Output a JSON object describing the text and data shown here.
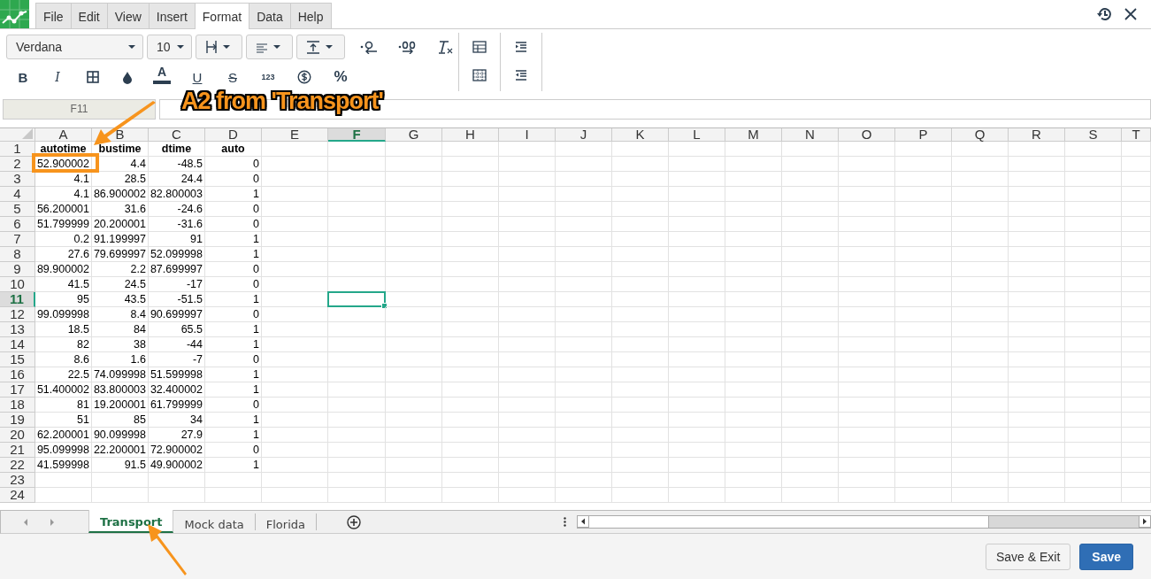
{
  "menu": [
    {
      "label": "File",
      "selected": false
    },
    {
      "label": "Edit",
      "selected": false
    },
    {
      "label": "View",
      "selected": false
    },
    {
      "label": "Insert",
      "selected": false
    },
    {
      "label": "Format",
      "selected": true
    },
    {
      "label": "Data",
      "selected": false
    },
    {
      "label": "Help",
      "selected": false
    }
  ],
  "toolbar": {
    "font": "Verdana",
    "size": "10",
    "style_labels": [
      "B",
      "I",
      "A",
      "U",
      "S",
      "123",
      "%"
    ]
  },
  "name_box": "F11",
  "columns": [
    {
      "label": "A",
      "selected": false
    },
    {
      "label": "B",
      "selected": false
    },
    {
      "label": "C",
      "selected": false
    },
    {
      "label": "D",
      "selected": false
    },
    {
      "label": "E",
      "selected": false
    },
    {
      "label": "F",
      "selected": true
    },
    {
      "label": "G",
      "selected": false
    },
    {
      "label": "H",
      "selected": false
    },
    {
      "label": "I",
      "selected": false
    },
    {
      "label": "J",
      "selected": false
    },
    {
      "label": "K",
      "selected": false
    },
    {
      "label": "L",
      "selected": false
    },
    {
      "label": "M",
      "selected": false
    },
    {
      "label": "N",
      "selected": false
    },
    {
      "label": "O",
      "selected": false
    },
    {
      "label": "P",
      "selected": false
    },
    {
      "label": "Q",
      "selected": false
    },
    {
      "label": "R",
      "selected": false
    },
    {
      "label": "S",
      "selected": false
    },
    {
      "label": "T",
      "selected": false
    }
  ],
  "rows": [
    {
      "label": "1",
      "kind": "header",
      "selected": false,
      "cells": [
        "autotime",
        "bustime",
        "dtime",
        "auto"
      ]
    },
    {
      "label": "2",
      "kind": "data",
      "selected": false,
      "cells": [
        "52.900002",
        "4.4",
        "-48.5",
        "0"
      ]
    },
    {
      "label": "3",
      "kind": "data",
      "selected": false,
      "cells": [
        "4.1",
        "28.5",
        "24.4",
        "0"
      ]
    },
    {
      "label": "4",
      "kind": "data",
      "selected": false,
      "cells": [
        "4.1",
        "86.900002",
        "82.800003",
        "1"
      ]
    },
    {
      "label": "5",
      "kind": "data",
      "selected": false,
      "cells": [
        "56.200001",
        "31.6",
        "-24.6",
        "0"
      ]
    },
    {
      "label": "6",
      "kind": "data",
      "selected": false,
      "cells": [
        "51.799999",
        "20.200001",
        "-31.6",
        "0"
      ]
    },
    {
      "label": "7",
      "kind": "data",
      "selected": false,
      "cells": [
        "0.2",
        "91.199997",
        "91",
        "1"
      ]
    },
    {
      "label": "8",
      "kind": "data",
      "selected": false,
      "cells": [
        "27.6",
        "79.699997",
        "52.099998",
        "1"
      ]
    },
    {
      "label": "9",
      "kind": "data",
      "selected": false,
      "cells": [
        "89.900002",
        "2.2",
        "87.699997",
        "0"
      ]
    },
    {
      "label": "10",
      "kind": "data",
      "selected": false,
      "cells": [
        "41.5",
        "24.5",
        "-17",
        "0"
      ]
    },
    {
      "label": "11",
      "kind": "data",
      "selected": true,
      "cells": [
        "95",
        "43.5",
        "-51.5",
        "1"
      ]
    },
    {
      "label": "12",
      "kind": "data",
      "selected": false,
      "cells": [
        "99.099998",
        "8.4",
        "90.699997",
        "0"
      ]
    },
    {
      "label": "13",
      "kind": "data",
      "selected": false,
      "cells": [
        "18.5",
        "84",
        "65.5",
        "1"
      ]
    },
    {
      "label": "14",
      "kind": "data",
      "selected": false,
      "cells": [
        "82",
        "38",
        "-44",
        "1"
      ]
    },
    {
      "label": "15",
      "kind": "data",
      "selected": false,
      "cells": [
        "8.6",
        "1.6",
        "-7",
        "0"
      ]
    },
    {
      "label": "16",
      "kind": "data",
      "selected": false,
      "cells": [
        "22.5",
        "74.099998",
        "51.599998",
        "1"
      ]
    },
    {
      "label": "17",
      "kind": "data",
      "selected": false,
      "cells": [
        "51.400002",
        "83.800003",
        "32.400002",
        "1"
      ]
    },
    {
      "label": "18",
      "kind": "data",
      "selected": false,
      "cells": [
        "81",
        "19.200001",
        "61.799999",
        "0"
      ]
    },
    {
      "label": "19",
      "kind": "data",
      "selected": false,
      "cells": [
        "51",
        "85",
        "34",
        "1"
      ]
    },
    {
      "label": "20",
      "kind": "data",
      "selected": false,
      "cells": [
        "62.200001",
        "90.099998",
        "27.9",
        "1"
      ]
    },
    {
      "label": "21",
      "kind": "data",
      "selected": false,
      "cells": [
        "95.099998",
        "22.200001",
        "72.900002",
        "0"
      ]
    },
    {
      "label": "22",
      "kind": "data",
      "selected": false,
      "cells": [
        "41.599998",
        "91.5",
        "49.900002",
        "1"
      ]
    },
    {
      "label": "23",
      "kind": "data",
      "selected": false,
      "cells": []
    },
    {
      "label": "24",
      "kind": "data",
      "selected": false,
      "cells": []
    }
  ],
  "sheets": [
    {
      "label": "Transport",
      "selected": true
    },
    {
      "label": "Mock data",
      "selected": false
    },
    {
      "label": "Florida",
      "selected": false
    }
  ],
  "buttons": [
    {
      "label": "Save & Exit",
      "kind": "secondary"
    },
    {
      "label": "Save",
      "kind": "primary"
    }
  ],
  "annotation": {
    "callout": "A2 from 'Transport'"
  }
}
